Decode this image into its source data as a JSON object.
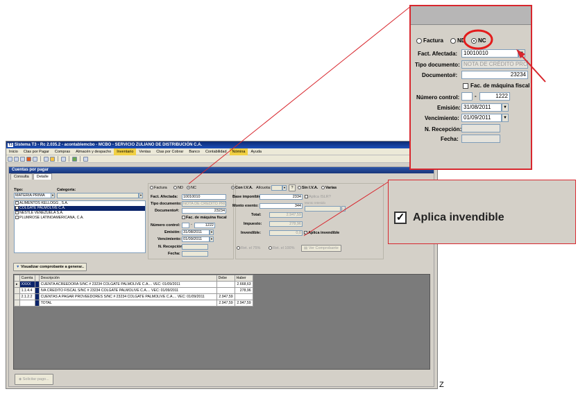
{
  "window": {
    "title": "Sistema T3 - Rc 2.035.2 - acontablemcbo - MCBO - SERVICIO ZULIANO DE DISTRIBUCIÓN C.A.",
    "logo": "T3"
  },
  "menu": [
    "Inicio",
    "Ctas por Pagar",
    "Compras",
    "Almacén y despacho",
    "Inventario",
    "Ventas",
    "Ctas por Cobrar",
    "Banco",
    "Contabilidad",
    "Nómina",
    "Ayuda"
  ],
  "panel": {
    "title": "Cuentas por pagar",
    "tabs": [
      "Consulta",
      "Detalle"
    ]
  },
  "left": {
    "tipo_label": "Tipo:",
    "tipo_value": "MATERIA PRIMA",
    "categoria_label": "Categoría:",
    "suppliers": [
      {
        "name": "ALIMENTOS KELLOGG , S.A.",
        "checked": false,
        "selected": false
      },
      {
        "name": "COLGATE PALMOLIVE C.A.",
        "checked": true,
        "selected": true
      },
      {
        "name": "NESTLE VENEZUELA S.A.",
        "checked": false,
        "selected": false
      },
      {
        "name": "PLUMROSE LATINOAMERICANA, C.A.",
        "checked": false,
        "selected": false
      }
    ]
  },
  "doc": {
    "radio_factura": "Factura",
    "radio_nd": "ND",
    "radio_nc": "NC",
    "fact_afectada_label": "Fact. Afectada:",
    "fact_afectada": "10010010",
    "tipo_documento_label": "Tipo documento:",
    "tipo_documento": "NOTA DE CRÉDITO PRO",
    "documento_label": "Documento#:",
    "documento": "23234",
    "fac_maquina": "Fac. de máquina fiscal",
    "numero_control_label": "Número control:",
    "numero_control": "1222",
    "emision_label": "Emisión:",
    "emision": "31/08/2011",
    "vencimiento_label": "Vencimiento:",
    "vencimiento": "01/09/2011",
    "recepcion_label": "N. Recepción:",
    "fecha_label": "Fecha:"
  },
  "iva": {
    "radio_con": "Con I.V.A.",
    "alicuota_label": "Alícuota:",
    "radio_sin": "Sin I.V.A.",
    "radio_varias": "Varias",
    "base_label": "Base imponible:",
    "base": "2334",
    "aplica_islr": "Aplica ISLR?",
    "monto_exento_label": "Monto exento:",
    "monto_exento": "344",
    "monto_retenido_label": "Monto retenido",
    "total_label": "Total:",
    "total": "2.947,59",
    "impuesto_label": "Impuesto:",
    "impuesto": "278,96",
    "invendible_label": "Invendible:",
    "invendible": "0,0",
    "aplica_invendible": "Aplica invendible",
    "ret75": "Ret. el 75%",
    "ret100": "Ret. el 100%",
    "ver_comprobante": "Ver Comprobante"
  },
  "visualizar_button": "Visualizar comprobante a generar..",
  "grid": {
    "headers": [
      "Cuenta",
      "Descripción",
      "Debe",
      "Haber"
    ],
    "rows": [
      {
        "cuenta": "XXXX",
        "descripcion": "CUENTA ACREEDORA S/NC # 23234 COLGATE PALMOLIVE C.A.... VEC: 01/09/2011",
        "debe": "",
        "haber": "2.668,63"
      },
      {
        "cuenta": "1.1.4.4",
        "descripcion": "IVA CREDITO FISCAL S/NC # 23234 COLGATE PALMOLIVE C.A.... VEC: 01/09/2011",
        "debe": "",
        "haber": "278,96"
      },
      {
        "cuenta": "2.1.2.2",
        "descripcion": "CUENTAS A PAGAR PROVEEDORES S/NC # 23234 COLGATE PALMOLIVE C.A.... VEC: 01/09/2011",
        "debe": "2.947,59",
        "haber": ""
      },
      {
        "cuenta": "",
        "descripcion": "TOTAL",
        "debe": "2.947,59",
        "haber": "2.947,59"
      }
    ]
  },
  "solicitar_button": "Solicitar pago...",
  "zoom_aplica_invendible": "Aplica invendible",
  "accent_red": "#d8262d"
}
